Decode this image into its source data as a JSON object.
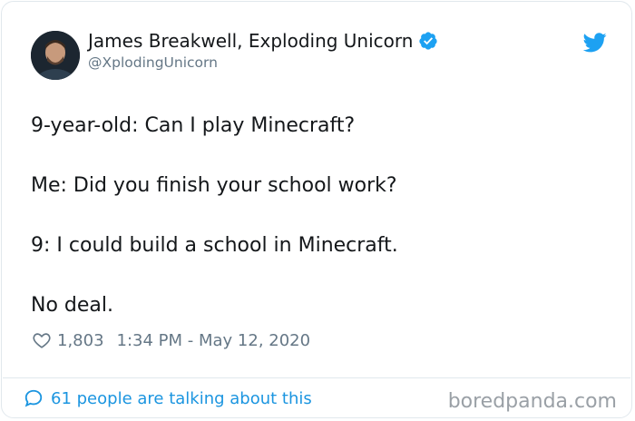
{
  "author": {
    "name": "James Breakwell, Exploding Unicorn",
    "handle": "@XplodingUnicorn",
    "verified_icon": "verified-badge-icon"
  },
  "tweet": {
    "lines": [
      "9-year-old: Can I play Minecraft?",
      "Me: Did you finish your school work?",
      "9: I could build a school in Minecraft.",
      "No deal."
    ],
    "likes": "1,803",
    "timestamp": "1:34 PM - May 12, 2020"
  },
  "footer": {
    "talking": "61 people are talking about this",
    "watermark": "boredpanda.com"
  },
  "colors": {
    "accent": "#1da1f2",
    "link": "#1b95e0",
    "muted": "#657786",
    "text": "#14171a"
  }
}
